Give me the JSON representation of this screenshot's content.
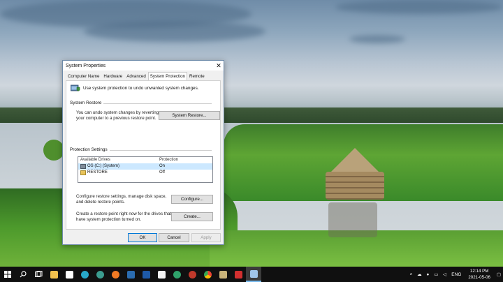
{
  "window": {
    "title": "System Properties",
    "close_glyph": "✕",
    "tabs": [
      {
        "label": "Computer Name"
      },
      {
        "label": "Hardware"
      },
      {
        "label": "Advanced"
      },
      {
        "label": "System Protection",
        "active": true
      },
      {
        "label": "Remote"
      }
    ],
    "intro_text": "Use system protection to undo unwanted system changes.",
    "system_restore": {
      "group_label": "System Restore",
      "description_line1": "You can undo system changes by reverting",
      "description_line2": "your computer to a previous restore point.",
      "button_label": "System Restore..."
    },
    "protection_settings": {
      "group_label": "Protection Settings",
      "columns": [
        "Available Drives",
        "Protection"
      ],
      "rows": [
        {
          "drive": "OS (C:) (System)",
          "protection": "On",
          "icon": "system-drive-icon"
        },
        {
          "drive": "RESTORE",
          "protection": "Off",
          "icon": "drive-icon"
        }
      ],
      "configure_text_line1": "Configure restore settings, manage disk space,",
      "configure_text_line2": "and delete restore points.",
      "configure_button": "Configure...",
      "create_text_line1": "Create a restore point right now for the drives that",
      "create_text_line2": "have system protection turned on.",
      "create_button": "Create..."
    },
    "footer": {
      "ok": "OK",
      "cancel": "Cancel",
      "apply": "Apply"
    }
  },
  "taskbar": {
    "icons": [
      "windows-start-icon",
      "search-icon",
      "task-view-icon",
      "file-explorer-icon",
      "store-icon",
      "edge-icon",
      "edge-dev-icon",
      "firefox-icon",
      "app-6-icon",
      "app-icon",
      "app-icon-2",
      "edge-beta-icon",
      "app-a-icon",
      "chrome-icon",
      "app-icon-3",
      "app-red-icon",
      "system-properties-icon"
    ],
    "tray": {
      "language": "ENG",
      "time": "12:14 PM",
      "date": "2021-05-06"
    }
  },
  "colors": {
    "accent": "#0078d7",
    "taskbar": "#101010",
    "selection": "#cce8ff"
  }
}
